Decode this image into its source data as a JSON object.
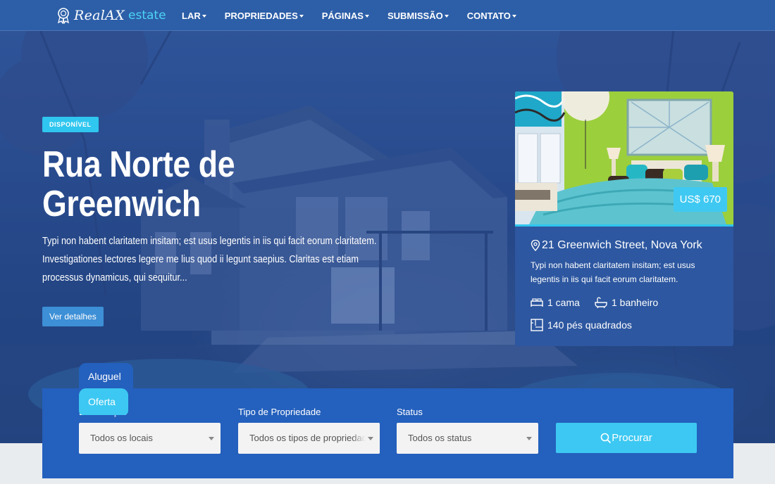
{
  "navbar": {
    "logo_main": "RealAX",
    "logo_sub": "estate",
    "items": [
      {
        "label": "LAR"
      },
      {
        "label": "PROPRIEDADES"
      },
      {
        "label": "PÁGINAS"
      },
      {
        "label": "SUBMISSÃO"
      },
      {
        "label": "CONTATO"
      }
    ]
  },
  "hero": {
    "badge": "DISPONÍVEL",
    "title": "Rua Norte de Greenwich",
    "description": "Typi non habent claritatem insitam; est usus legentis in iis qui facit eorum claritatem. Investigationes lectores legere me lius quod ii legunt saepius. Claritas est etiam processus dynamicus, qui sequitur...",
    "button_label": "Ver detalhes"
  },
  "card": {
    "price": "US$ 670",
    "address": "21 Greenwich Street, Nova York",
    "description": "Typi non habent claritatem insitam; est usus legentis in iis qui facit eorum claritatem.",
    "beds": "1 cama",
    "baths": "1 banheiro",
    "area": "140 pés quadrados"
  },
  "search": {
    "tabs": [
      {
        "label": "Aluguel"
      },
      {
        "label": "Oferta"
      }
    ],
    "location_label": "Localização",
    "location_value": "Todos os locais",
    "type_label": "Tipo de Propriedade",
    "type_value": "Todos os tipos de propriedade",
    "status_label": "Status",
    "status_value": "Todos os status",
    "button_label": "Procurar"
  },
  "colors": {
    "navbar": "#2d5fa8",
    "accent": "#3cc8f2",
    "search_panel": "#2460bd",
    "card": "#2d57a0"
  }
}
